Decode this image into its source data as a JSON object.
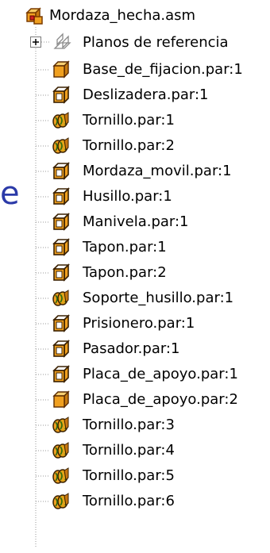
{
  "root": {
    "label": "Mordaza_hecha.asm",
    "icon": "assembly-icon"
  },
  "reference_planes": {
    "label": "Planos de referencia",
    "icon": "reference-planes-icon",
    "expander": "+"
  },
  "items": [
    {
      "label": "Base_de_fijacion.par:1",
      "icon": "part-solid-icon"
    },
    {
      "label": "Deslizadera.par:1",
      "icon": "part-icon"
    },
    {
      "label": "Tornillo.par:1",
      "icon": "fastener-icon"
    },
    {
      "label": "Tornillo.par:2",
      "icon": "fastener-icon"
    },
    {
      "label": "Mordaza_movil.par:1",
      "icon": "part-icon"
    },
    {
      "label": "Husillo.par:1",
      "icon": "part-icon"
    },
    {
      "label": "Manivela.par:1",
      "icon": "part-icon"
    },
    {
      "label": "Tapon.par:1",
      "icon": "part-icon"
    },
    {
      "label": "Tapon.par:2",
      "icon": "part-icon"
    },
    {
      "label": "Soporte_husillo.par:1",
      "icon": "fastener-icon"
    },
    {
      "label": "Prisionero.par:1",
      "icon": "part-icon"
    },
    {
      "label": "Pasador.par:1",
      "icon": "part-icon"
    },
    {
      "label": "Placa_de_apoyo.par:1",
      "icon": "part-icon"
    },
    {
      "label": "Placa_de_apoyo.par:2",
      "icon": "part-solid-icon"
    },
    {
      "label": "Tornillo.par:3",
      "icon": "fastener-icon"
    },
    {
      "label": "Tornillo.par:4",
      "icon": "fastener-icon"
    },
    {
      "label": "Tornillo.par:5",
      "icon": "fastener-icon"
    },
    {
      "label": "Tornillo.par:6",
      "icon": "fastener-icon"
    }
  ],
  "stray_text": "e",
  "colors": {
    "orange": "#f0a020",
    "guide": "#9a9a9a",
    "text": "#000000",
    "stray": "#2b3aa8"
  }
}
